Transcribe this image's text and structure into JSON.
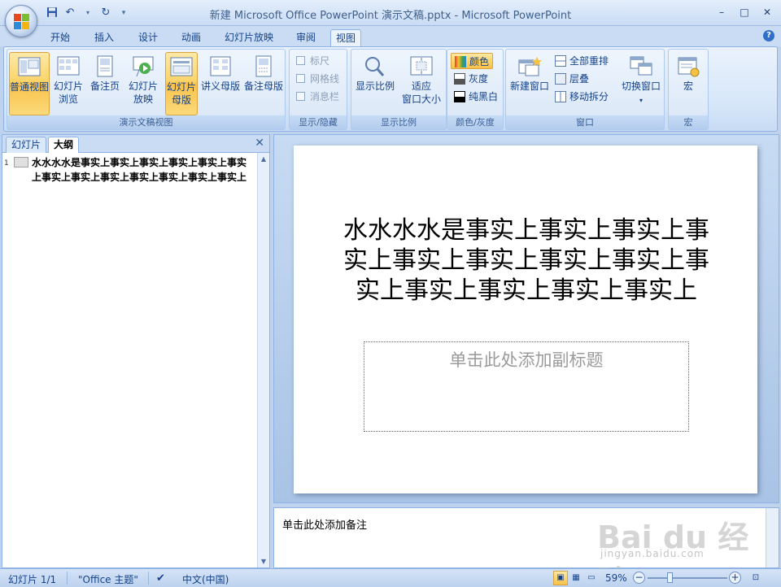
{
  "window": {
    "title": "新建 Microsoft Office PowerPoint 演示文稿.pptx - Microsoft PowerPoint",
    "controls": [
      "–",
      "□",
      "✕"
    ]
  },
  "qat": {
    "save_icon": "save-icon",
    "undo_icon": "undo-icon",
    "redo_icon": "redo-icon",
    "customize_icon": "qat-dropdown-icon"
  },
  "tabs": [
    "开始",
    "插入",
    "设计",
    "动画",
    "幻灯片放映",
    "审阅",
    "视图"
  ],
  "active_tab": "视图",
  "ribbon": {
    "presentation_views": {
      "label": "演示文稿视图",
      "buttons": [
        {
          "label1": "普通视图",
          "label2": "",
          "active": true
        },
        {
          "label1": "幻灯片",
          "label2": "浏览",
          "active": false
        },
        {
          "label1": "备注页",
          "label2": "",
          "active": false
        },
        {
          "label1": "幻灯片",
          "label2": "放映",
          "active": false
        },
        {
          "label1": "幻灯片",
          "label2": "母版",
          "active": true
        },
        {
          "label1": "讲义母版",
          "label2": "",
          "active": false
        },
        {
          "label1": "备注母版",
          "label2": "",
          "active": false
        }
      ]
    },
    "show_hide": {
      "label": "显示/隐藏",
      "items": [
        "标尺",
        "网格线",
        "消息栏"
      ]
    },
    "zoom": {
      "label": "显示比例",
      "zoom_btn": "显示比例",
      "fit_btn_1": "适应",
      "fit_btn_2": "窗口大小"
    },
    "color": {
      "label": "颜色/灰度",
      "items": [
        "颜色",
        "灰度",
        "纯黑白"
      ]
    },
    "window": {
      "label": "窗口",
      "new_window": "新建窗口",
      "arrange_all": "全部重排",
      "cascade": "层叠",
      "move_split": "移动拆分",
      "switch_windows": "切换窗口"
    },
    "macros": {
      "label": "宏",
      "button": "宏"
    }
  },
  "left_pane": {
    "tabs": [
      "幻灯片",
      "大纲"
    ],
    "active_tab": "大纲",
    "close": "✕",
    "outline": {
      "num": "1",
      "text": "水水水水是事实上事实上事实上事实上事实上事实上事实上事实上事实上事实上事实上事实上事实上"
    }
  },
  "slide": {
    "title": "水水水水是事实上事实上事实上事实上事实上事实上事实上事实上事实上事实上事实上事实上事实上",
    "subtitle_placeholder": "单击此处添加副标题"
  },
  "notes": {
    "placeholder": "单击此处添加备注"
  },
  "watermark": {
    "logo": "Bai du 经验",
    "url": "jingyan.baidu.com"
  },
  "status": {
    "slide": "幻灯片 1/1",
    "theme": "\"Office 主题\"",
    "language": "中文(中国)",
    "zoom": "59%",
    "zoom_level": 0.59
  },
  "colors": {
    "accent": "#15428b",
    "ribbon": "#dde9f8",
    "active": "#fbd46b"
  }
}
